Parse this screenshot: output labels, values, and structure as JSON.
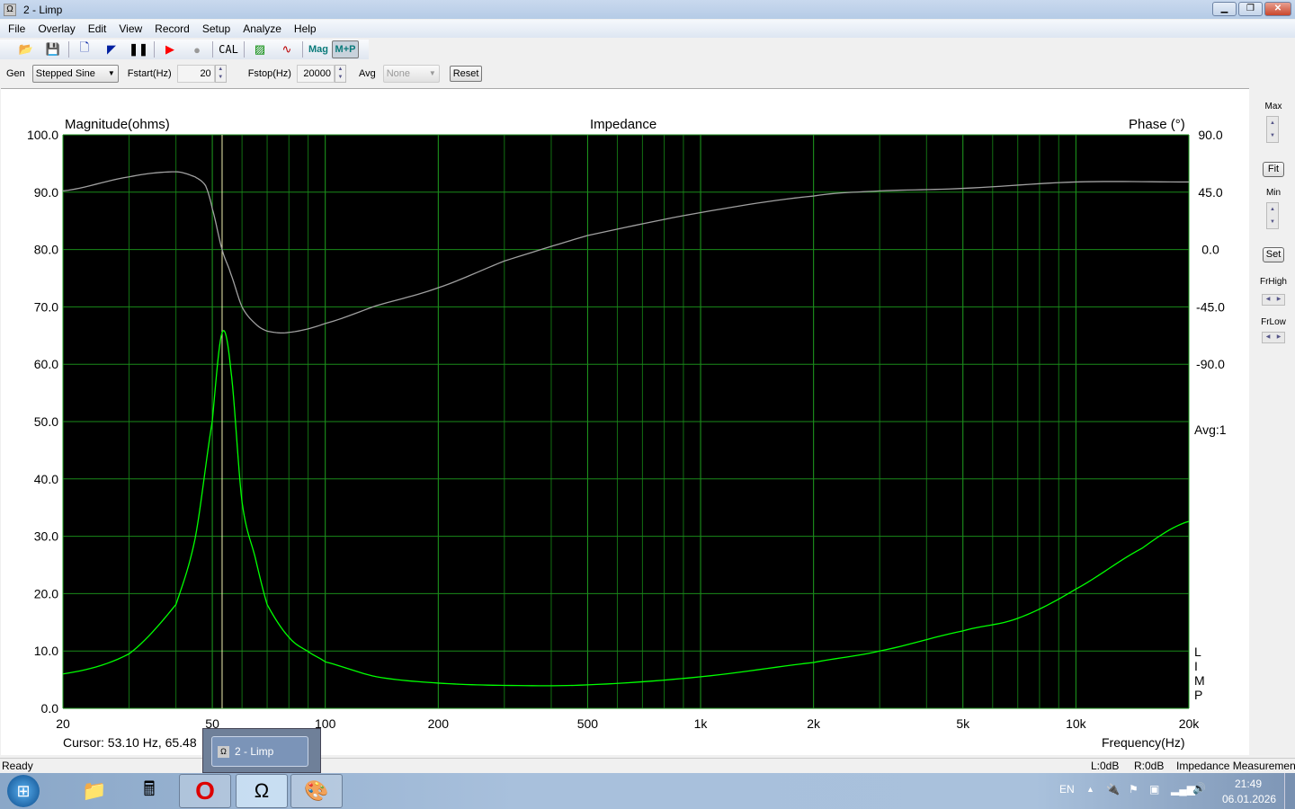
{
  "window": {
    "title": "2 - Limp",
    "app_icon": "omega-icon",
    "controls": [
      "minimize",
      "maximize",
      "close"
    ]
  },
  "menu": [
    "File",
    "Overlay",
    "Edit",
    "View",
    "Record",
    "Setup",
    "Analyze",
    "Help"
  ],
  "toolbar": {
    "cal_label": "CAL",
    "mag_label": "Mag",
    "mp_label": "M+P"
  },
  "gen": {
    "gen_label": "Gen",
    "gen_value": "Stepped Sine",
    "fstart_label": "Fstart(Hz)",
    "fstart_value": "20",
    "fstop_label": "Fstop(Hz)",
    "fstop_value": "20000",
    "avg_label": "Avg",
    "avg_value": "None",
    "reset_label": "Reset"
  },
  "right_panel": {
    "max_label": "Max",
    "fit_label": "Fit",
    "min_label": "Min",
    "set_label": "Set",
    "frhigh_label": "FrHigh",
    "frlow_label": "FrLow"
  },
  "chart_data": {
    "type": "line",
    "title": "Impedance",
    "ylabel": "Magnitude(ohms)",
    "y2label": "Phase (°)",
    "xlabel": "Frequency(Hz)",
    "x_scale": "log",
    "xlim": [
      20,
      20000
    ],
    "ylim": [
      0,
      100
    ],
    "y2lim": [
      -90,
      90
    ],
    "x_ticks": [
      {
        "v": 20,
        "label": "20"
      },
      {
        "v": 50,
        "label": "50"
      },
      {
        "v": 100,
        "label": "100"
      },
      {
        "v": 200,
        "label": "200"
      },
      {
        "v": 500,
        "label": "500"
      },
      {
        "v": 1000,
        "label": "1k"
      },
      {
        "v": 2000,
        "label": "2k"
      },
      {
        "v": 5000,
        "label": "5k"
      },
      {
        "v": 10000,
        "label": "10k"
      },
      {
        "v": 20000,
        "label": "20k"
      }
    ],
    "y_ticks": [
      "0.0",
      "10.0",
      "20.0",
      "30.0",
      "40.0",
      "50.0",
      "60.0",
      "70.0",
      "80.0",
      "90.0",
      "100.0"
    ],
    "y2_ticks": [
      {
        "v": 90,
        "label": "90.0"
      },
      {
        "v": 45,
        "label": "45.0"
      },
      {
        "v": 0,
        "label": "0.0"
      },
      {
        "v": -45,
        "label": "-45.0"
      },
      {
        "v": -90,
        "label": "-90.0"
      }
    ],
    "grid": true,
    "background": "#000000",
    "avg_text": "Avg:1",
    "side_letters": [
      "L",
      "I",
      "M",
      "P"
    ],
    "cursor": {
      "freq": 53.1,
      "text": "Cursor: 53.10 Hz, 65.48"
    },
    "series": [
      {
        "key": "magnitude",
        "color": "#00ff00",
        "axis": "left",
        "x": [
          20,
          30,
          40,
          45,
          50,
          53.1,
          56,
          60,
          65,
          70,
          80,
          90,
          100,
          137,
          200,
          300,
          500,
          1000,
          2000,
          3000,
          5000,
          7000,
          10000,
          15000,
          20000
        ],
        "y": [
          6.0,
          9.5,
          18.1,
          29.6,
          50.1,
          65.48,
          59.1,
          36.0,
          26.4,
          18.1,
          12.4,
          9.9,
          8.1,
          5.5,
          4.4,
          4.0,
          4.1,
          5.5,
          8.0,
          10.0,
          13.5,
          15.7,
          20.8,
          27.9,
          32.6
        ]
      },
      {
        "key": "phase",
        "color": "#a0a0a0",
        "axis": "right",
        "x": [
          20,
          30,
          40,
          45,
          48,
          50,
          53.1,
          56,
          60,
          65,
          70,
          80,
          100,
          137,
          200,
          300,
          500,
          1000,
          2000,
          3000,
          5000,
          10000,
          20000
        ],
        "y": [
          46,
          57,
          61,
          57,
          50,
          32,
          0,
          -19,
          -45,
          -58,
          -64,
          -65,
          -58,
          -44,
          -30,
          -9,
          11,
          29,
          42,
          46,
          48,
          53,
          53
        ]
      }
    ]
  },
  "status": {
    "ready": "Ready",
    "left": "L:0dB",
    "right": "R:0dB",
    "mode": "Impedance Measuremen"
  },
  "taskbar": {
    "popup_label": "2 - Limp",
    "lang": "EN",
    "time": "21:49",
    "date": "06.01.2026"
  }
}
